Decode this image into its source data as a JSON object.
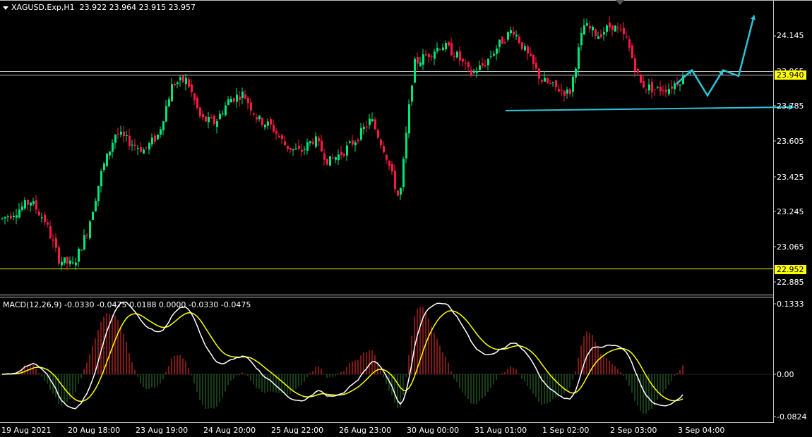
{
  "header": {
    "symbol": "XAGUSD.Exp,H1",
    "ohlc": "23.922 23.964 23.915 23.957",
    "dropdown_icon": "triangle-down-icon"
  },
  "price_axis": {
    "labels": [
      "24.145",
      "23.965",
      "23.785",
      "23.605",
      "23.425",
      "23.245",
      "23.065",
      "22.885"
    ],
    "current_price": "23.940",
    "current_price_color": "#ffff00",
    "support_price": "22.952",
    "support_color": "#ffff00"
  },
  "macd": {
    "label": "MACD(12,26,9) -0.0330 -0.0475 0.0188 0.0000 -0.0330 -0.0475",
    "axis_labels": [
      "0.1333",
      "0.00",
      "-0.0824"
    ],
    "main_line_color": "#ffffff",
    "signal_line_color": "#ffff00",
    "hist_pos_color": "#ff3030",
    "hist_neg_color": "#2e7d32"
  },
  "time_axis": {
    "labels": [
      "19 Aug 2021",
      "20 Aug 18:00",
      "23 Aug 19:00",
      "24 Aug 20:00",
      "25 Aug 22:00",
      "26 Aug 23:00",
      "30 Aug 00:00",
      "31 Aug 01:00",
      "1 Sep 02:00",
      "2 Sep 03:00",
      "3 Sep 04:00"
    ]
  },
  "colors": {
    "bull_candle": "#00e676",
    "bear_candle": "#ff1744",
    "trendline": "#2ec4d6",
    "grid_line": "#c0c0c0"
  },
  "chart_data": {
    "type": "candlestick",
    "close_path": [
      23.21,
      23.25,
      23.3,
      23.2,
      23.0,
      22.97,
      23.15,
      23.45,
      23.65,
      23.6,
      23.56,
      23.64,
      23.9,
      23.92,
      23.72,
      23.7,
      23.82,
      23.85,
      23.72,
      23.68,
      23.58,
      23.55,
      23.62,
      23.5,
      23.55,
      23.62,
      23.72,
      23.55,
      23.3,
      24.0,
      24.05,
      24.1,
      24.05,
      23.95,
      24.0,
      24.1,
      24.18,
      24.05,
      23.92,
      23.88,
      23.85,
      24.2,
      24.15,
      24.2,
      24.13,
      23.9,
      23.87,
      23.88,
      23.93
    ],
    "ylim": [
      22.85,
      24.3
    ],
    "forecast_path": [
      23.9,
      23.97,
      23.84,
      23.97,
      23.94,
      24.25
    ]
  }
}
